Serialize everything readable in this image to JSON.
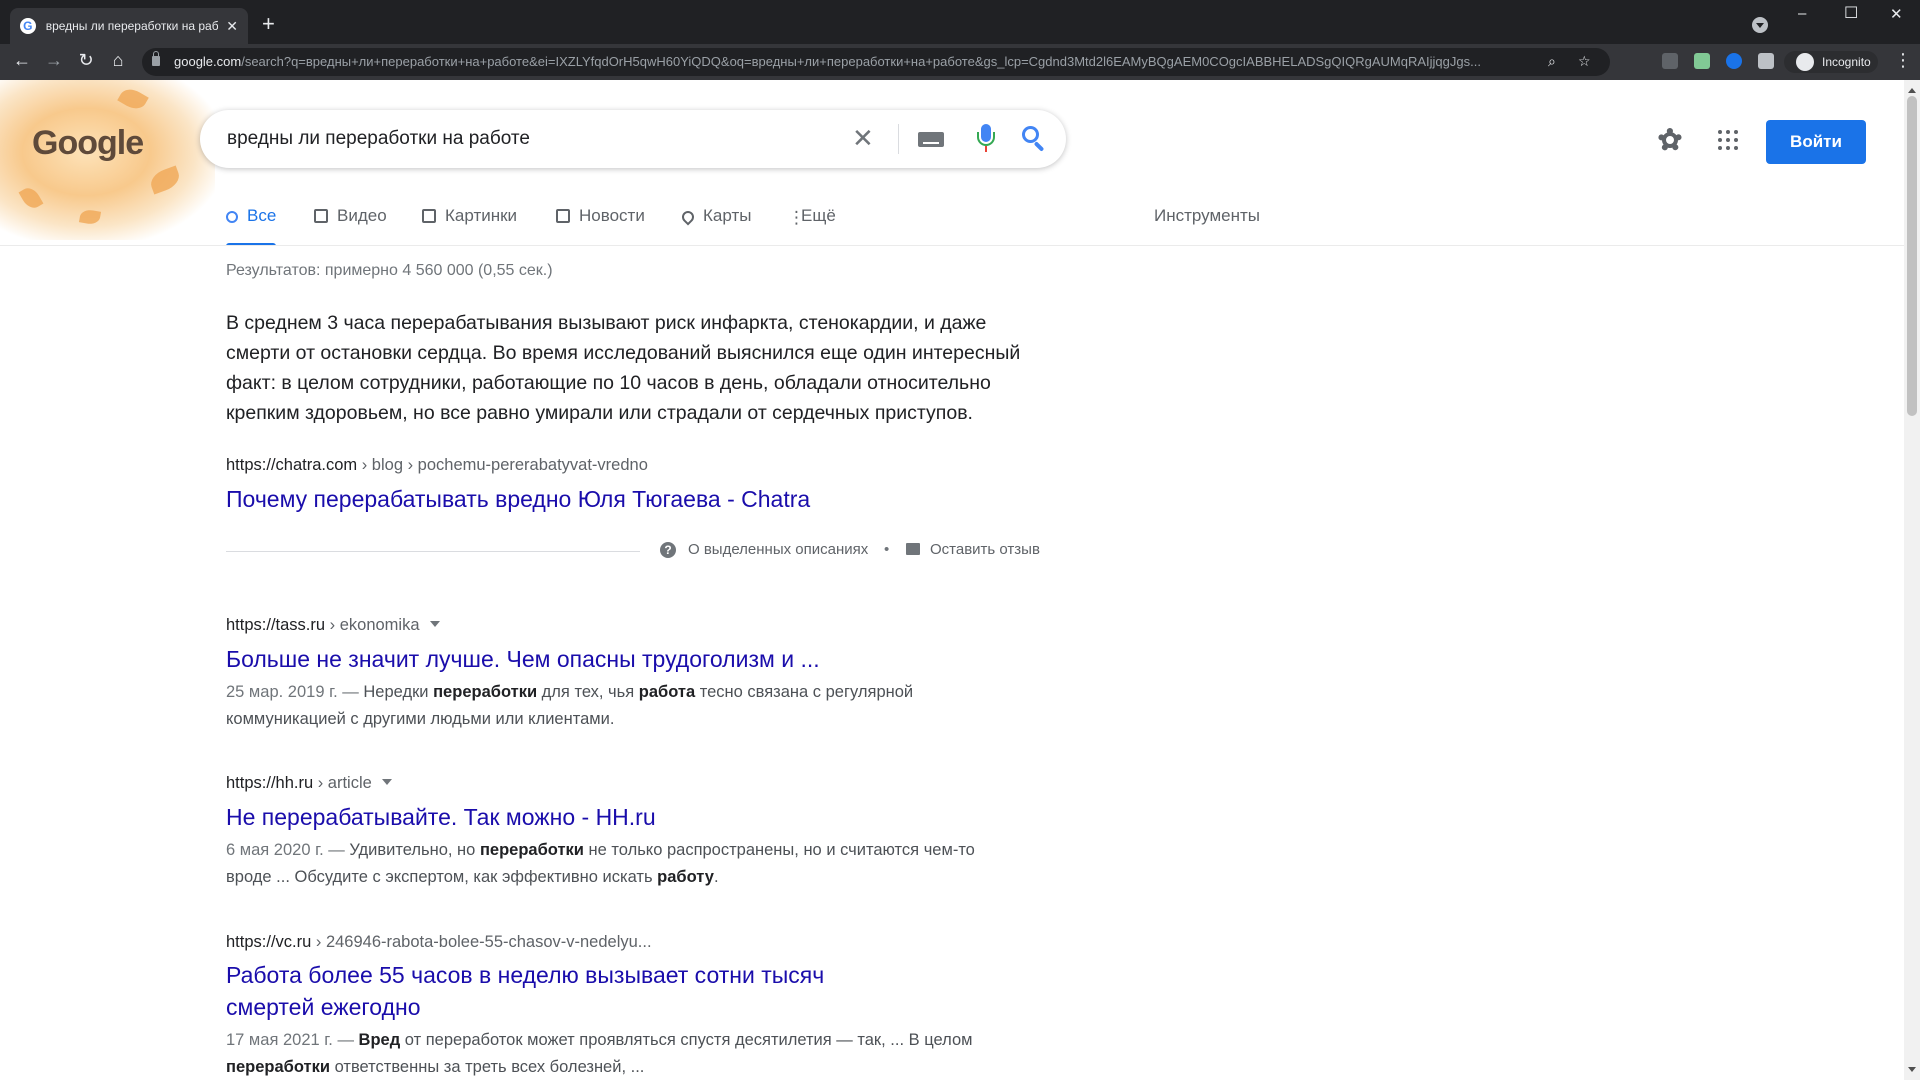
{
  "browser": {
    "tab_title": "вредны ли переработки на раб",
    "favicon_letter": "G",
    "new_tab": "+",
    "url_host": "google.com",
    "url_rest": "/search?q=вредны+ли+переработки+на+работе&ei=IXZLYfqdOrH5qwH60YiQDQ&oq=вредны+ли+переработки+на+работе&gs_lcp=Cgdnd3Mtd2l6EAMyBQgAEM0COgcIABBHELADSgQIQRgAUMqRAIjjqgJgs...",
    "profile_label": "Incognito"
  },
  "search": {
    "query": "вредны ли переработки на работе",
    "clear_glyph": "✕"
  },
  "header": {
    "logo_text": "Google",
    "signin_label": "Войти"
  },
  "nav": {
    "tabs": [
      {
        "label": "Все",
        "icon": "search-icon",
        "active": true
      },
      {
        "label": "Видео",
        "icon": "video-icon",
        "active": false
      },
      {
        "label": "Картинки",
        "icon": "image-icon",
        "active": false
      },
      {
        "label": "Новости",
        "icon": "news-icon",
        "active": false
      },
      {
        "label": "Карты",
        "icon": "map-pin-icon",
        "active": false
      },
      {
        "label": "Ещё",
        "icon": "more-vert-icon",
        "active": false
      }
    ],
    "tools": "Инструменты"
  },
  "stats": "Результатов: примерно 4 560 000 (0,55 сек.)",
  "featured": {
    "snippet": "В среднем 3 часа перерабатывания вызывают риск инфаркта, стенокардии, и даже смерти от остановки сердца. Во время исследований выяснился еще один интересный факт: в целом сотрудники, работающие по 10 часов в день, обладали относительно крепким здоровьем, но все равно умирали или страдали от сердечных приступов.",
    "cite_host": "https://chatra.com",
    "cite_path": " › blog › pochemu-pererabatyvat-vredno",
    "title": "Почему перерабатывать вредно Юля Тюгаева - Chatra",
    "about_label": "О выделенных описаниях",
    "separator": "•",
    "feedback_label": "Оставить отзыв"
  },
  "results": [
    {
      "cite_host": "https://tass.ru",
      "cite_path": " › ekonomika",
      "title": "Больше не значит лучше. Чем опасны трудоголизм и ...",
      "date": "25 мар. 2019 г. — ",
      "desc_parts": [
        "Нередки ",
        "переработки",
        " для тех, чья ",
        "работа",
        " тесно связана с регулярной коммуникацией с другими людьми или клиентами."
      ]
    },
    {
      "cite_host": "https://hh.ru",
      "cite_path": " › article",
      "title": "Не перерабатывайте. Так можно - HH.ru",
      "date": "6 мая 2020 г. — ",
      "desc_parts": [
        "Удивительно, но ",
        "переработки",
        " не только распространены, но и считаются чем-то вроде ... Обсудите с экспертом, как эффективно искать ",
        "работу",
        "."
      ]
    },
    {
      "cite_host": "https://vc.ru",
      "cite_path": " › 246946-rabota-bolee-55-chasov-v-nedelyu...",
      "title_line1": "Работа более 55 часов в неделю вызывает сотни тысяч",
      "title_line2": "смертей ежегодно",
      "date": "17 мая 2021 г. — ",
      "desc_parts": [
        "Вред",
        " от переработок может проявляться спустя десятилетия — так, ... В целом ",
        "переработки",
        " ответственны за треть всех болезней, ..."
      ]
    }
  ],
  "colors": {
    "link": "#1a0dab",
    "accent": "#1a73e8",
    "chrome_dark": "#202124"
  }
}
